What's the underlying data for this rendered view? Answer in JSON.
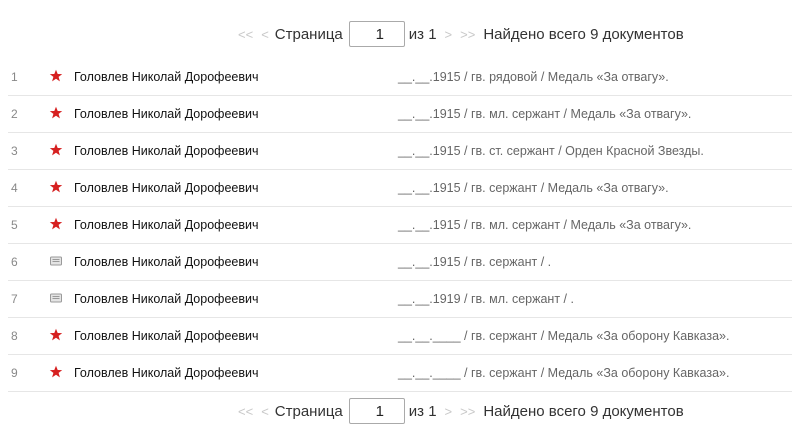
{
  "pager": {
    "first": "<<",
    "prev": "<",
    "page_label": "Страница",
    "page_value": "1",
    "of_label": "из 1",
    "next": ">",
    "last": ">>",
    "total_text": "Найдено всего 9 документов"
  },
  "colors": {
    "star": "#d62020",
    "doc_icon": "#9a9a9a"
  },
  "rows": [
    {
      "num": "1",
      "icon": "star-icon",
      "name": "Головлев Николай Дорофеевич",
      "info": "__.__.1915 /  гв. рядовой /  Медаль «За отвагу»."
    },
    {
      "num": "2",
      "icon": "star-icon",
      "name": "Головлев Николай Дорофеевич",
      "info": "__.__.1915 /  гв. мл. сержант /  Медаль «За отвагу»."
    },
    {
      "num": "3",
      "icon": "star-icon",
      "name": "Головлев Николай Дорофеевич",
      "info": "__.__.1915 /  гв. ст. сержант /  Орден Красной Звезды."
    },
    {
      "num": "4",
      "icon": "star-icon",
      "name": "Головлев Николай Дорофеевич",
      "info": "__.__.1915 /  гв. сержант /  Медаль «За отвагу»."
    },
    {
      "num": "5",
      "icon": "star-icon",
      "name": "Головлев Николай Дорофеевич",
      "info": "__.__.1915 /  гв. мл. сержант /  Медаль «За отвагу»."
    },
    {
      "num": "6",
      "icon": "document-icon",
      "name": "Головлев Николай Дорофеевич",
      "info": "__.__.1915 /  гв. сержант /  ."
    },
    {
      "num": "7",
      "icon": "document-icon",
      "name": "Головлев Николай Дорофеевич",
      "info": "__.__.1919 /  гв. мл. сержант /  ."
    },
    {
      "num": "8",
      "icon": "star-icon",
      "name": "Головлев Николай Дорофеевич",
      "info": "__.__.____ /  гв. сержант /  Медаль «За оборону Кавказа»."
    },
    {
      "num": "9",
      "icon": "star-icon",
      "name": "Головлев Николай Дорофеевич",
      "info": "__.__.____ /  гв. сержант /  Медаль «За оборону Кавказа»."
    }
  ]
}
